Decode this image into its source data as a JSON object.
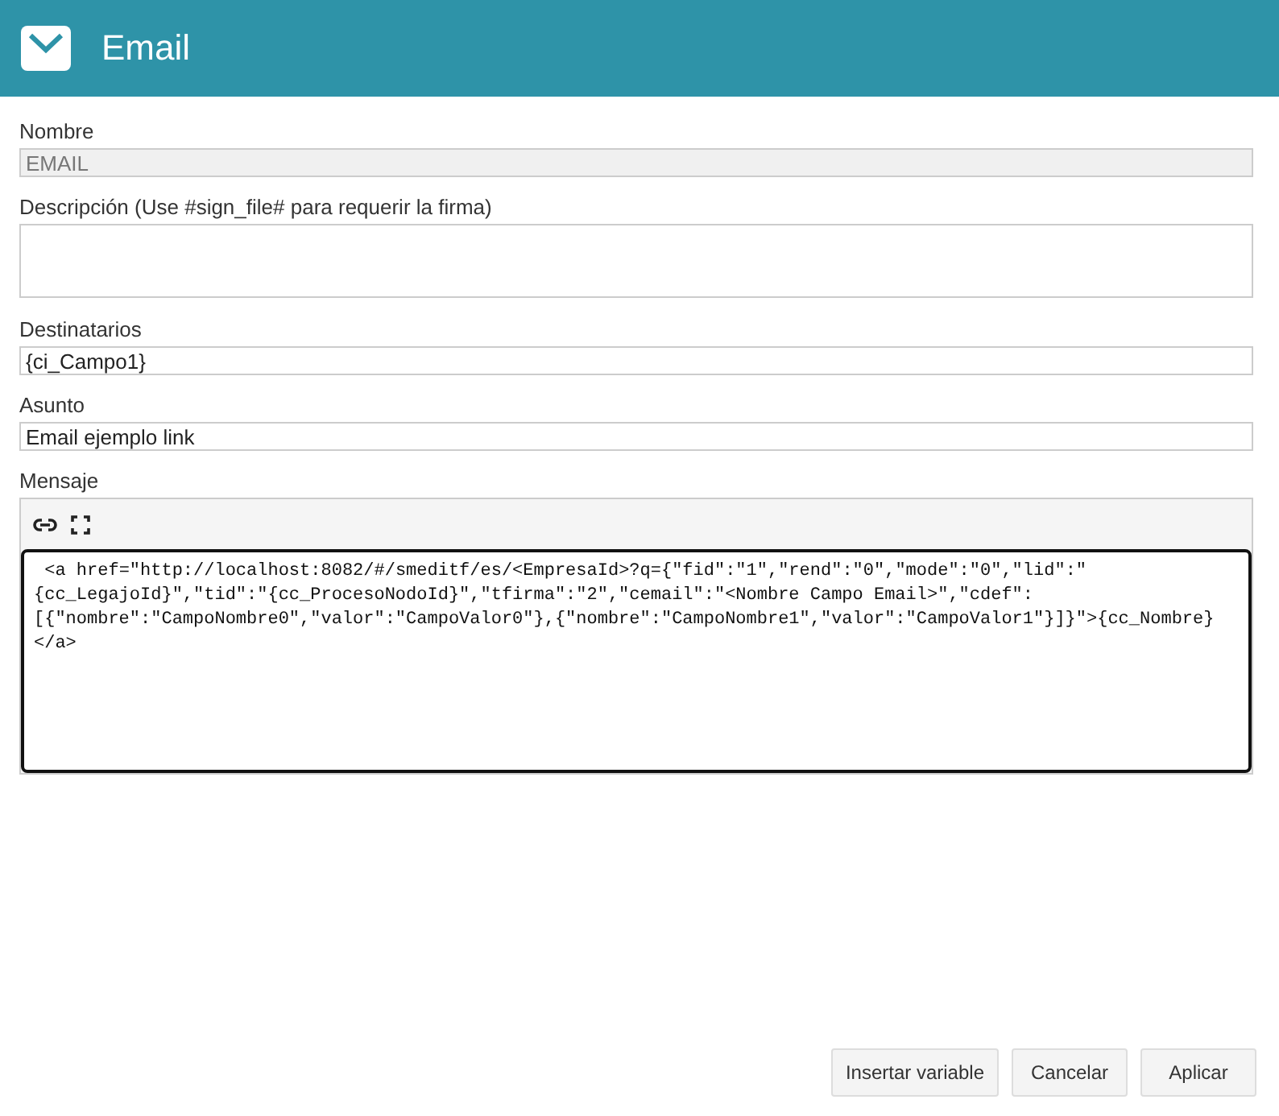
{
  "header": {
    "title": "Email"
  },
  "fields": [
    {
      "label": "Nombre",
      "kind": "input",
      "value": "EMAIL",
      "disabled": true
    },
    {
      "label": "Descripción (Use #sign_file# para requerir la firma)",
      "kind": "textarea",
      "disabled": false
    },
    {
      "label": "Destinatarios",
      "kind": "input",
      "value": "{ci_Campo1}",
      "disabled": false
    },
    {
      "label": "Asunto",
      "kind": "input",
      "value": "Email ejemplo link",
      "disabled": false
    }
  ],
  "message": {
    "label": "Mensaje",
    "value": " <a href=\"http://localhost:8082/#/smeditf/es/<EmpresaId>?q={\"fid\":\"1\",\"rend\":\"0\",\"mode\":\"0\",\"lid\":\"{cc_LegajoId}\",\"tid\":\"{cc_ProcesoNodoId}\",\"tfirma\":\"2\",\"cemail\":\"<Nombre Campo Email>\",\"cdef\":[{\"nombre\":\"CampoNombre0\",\"valor\":\"CampoValor0\"},{\"nombre\":\"CampoNombre1\",\"valor\":\"CampoValor1\"}]}\">{cc_Nombre}</a>"
  },
  "buttons": [
    "Insertar variable",
    "Cancelar",
    "Aplicar"
  ]
}
